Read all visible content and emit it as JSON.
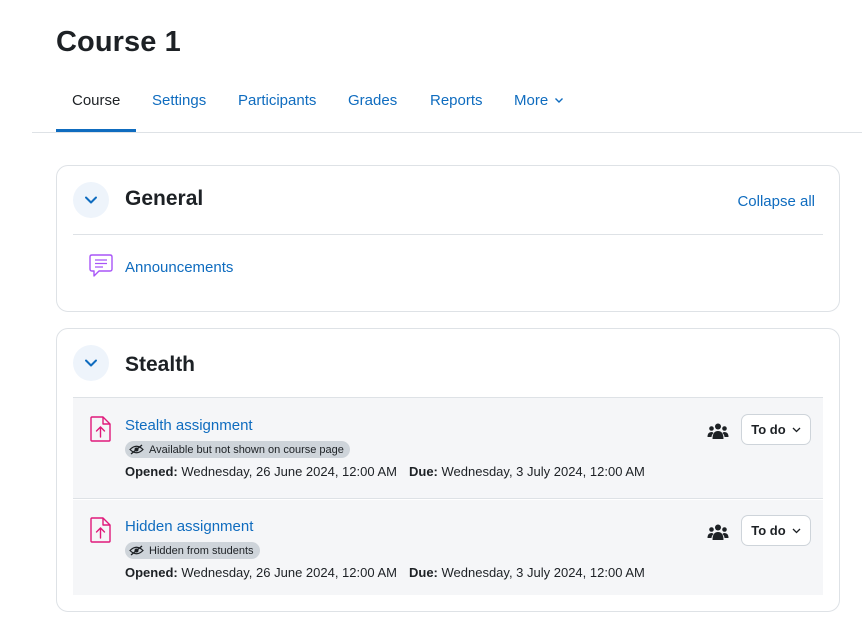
{
  "page": {
    "title": "Course 1"
  },
  "nav": {
    "items": [
      {
        "label": "Course"
      },
      {
        "label": "Settings"
      },
      {
        "label": "Participants"
      },
      {
        "label": "Grades"
      },
      {
        "label": "Reports"
      },
      {
        "label": "More"
      }
    ],
    "active_index": 0
  },
  "sections": [
    {
      "title": "General",
      "collapse_all_label": "Collapse all",
      "activities": [
        {
          "name": "Announcements",
          "icon": "forum-icon"
        }
      ]
    },
    {
      "title": "Stealth",
      "activities": [
        {
          "name": "Stealth assignment",
          "icon": "assignment-icon",
          "badge": "Available but not shown on course page",
          "opened_label": "Opened:",
          "opened_value": "Wednesday, 26 June 2024, 12:00 AM",
          "due_label": "Due:",
          "due_value": "Wednesday, 3 July 2024, 12:00 AM",
          "completion_label": "To do"
        },
        {
          "name": "Hidden assignment",
          "icon": "assignment-icon",
          "badge": "Hidden from students",
          "opened_label": "Opened:",
          "opened_value": "Wednesday, 26 June 2024, 12:00 AM",
          "due_label": "Due:",
          "due_value": "Wednesday, 3 July 2024, 12:00 AM",
          "completion_label": "To do"
        }
      ]
    }
  ],
  "colors": {
    "link": "#0f6cbf",
    "text": "#1d2125",
    "forum_icon": "#a855f7",
    "assignment_icon": "#e0197a",
    "badge_bg": "#ced4da",
    "border": "#dee2e6"
  }
}
